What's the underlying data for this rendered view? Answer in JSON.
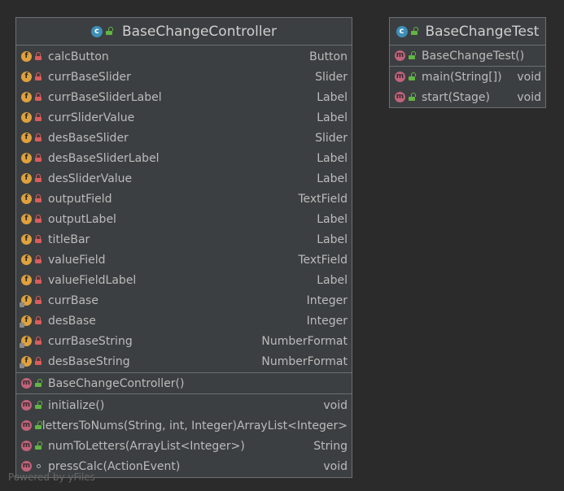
{
  "classes": [
    {
      "name": "BaseChangeController",
      "fields": [
        {
          "name": "calcButton",
          "type": "Button",
          "access": "private",
          "final": false
        },
        {
          "name": "currBaseSlider",
          "type": "Slider",
          "access": "private",
          "final": false
        },
        {
          "name": "currBaseSliderLabel",
          "type": "Label",
          "access": "private",
          "final": false
        },
        {
          "name": "currSliderValue",
          "type": "Label",
          "access": "private",
          "final": false
        },
        {
          "name": "desBaseSlider",
          "type": "Slider",
          "access": "private",
          "final": false
        },
        {
          "name": "desBaseSliderLabel",
          "type": "Label",
          "access": "private",
          "final": false
        },
        {
          "name": "desSliderValue",
          "type": "Label",
          "access": "private",
          "final": false
        },
        {
          "name": "outputField",
          "type": "TextField",
          "access": "private",
          "final": false
        },
        {
          "name": "outputLabel",
          "type": "Label",
          "access": "private",
          "final": false
        },
        {
          "name": "titleBar",
          "type": "Label",
          "access": "private",
          "final": false
        },
        {
          "name": "valueField",
          "type": "TextField",
          "access": "private",
          "final": false
        },
        {
          "name": "valueFieldLabel",
          "type": "Label",
          "access": "private",
          "final": false
        },
        {
          "name": "currBase",
          "type": "Integer",
          "access": "private",
          "final": true
        },
        {
          "name": "desBase",
          "type": "Integer",
          "access": "private",
          "final": true
        },
        {
          "name": "currBaseString",
          "type": "NumberFormat",
          "access": "private",
          "final": true
        },
        {
          "name": "desBaseString",
          "type": "NumberFormat",
          "access": "private",
          "final": true
        }
      ],
      "constructors": [
        {
          "name": "BaseChangeController()",
          "type": "",
          "access": "public"
        }
      ],
      "methods": [
        {
          "name": "initialize()",
          "type": "void",
          "access": "public"
        },
        {
          "name": "lettersToNums(String, int, Integer)",
          "type": "ArrayList<Integer>",
          "access": "public"
        },
        {
          "name": "numToLetters(ArrayList<Integer>)",
          "type": "String",
          "access": "public"
        },
        {
          "name": "pressCalc(ActionEvent)",
          "type": "void",
          "access": "package"
        }
      ]
    },
    {
      "name": "BaseChangeTest",
      "fields": [],
      "constructors": [
        {
          "name": "BaseChangeTest()",
          "type": "",
          "access": "public"
        }
      ],
      "methods": [
        {
          "name": "main(String[])",
          "type": "void",
          "access": "public"
        },
        {
          "name": "start(Stage)",
          "type": "void",
          "access": "public"
        }
      ]
    }
  ],
  "watermark": "Powered by yFiles",
  "icons": {
    "class": "class-icon",
    "field": "field-icon",
    "method": "method-icon"
  },
  "colors": {
    "field_badge": "#e0a13c",
    "method_badge": "#c0637a",
    "private_lock": "#db5c5c",
    "public_unlock": "#62b543",
    "class_icon": "#3d8fb8"
  }
}
